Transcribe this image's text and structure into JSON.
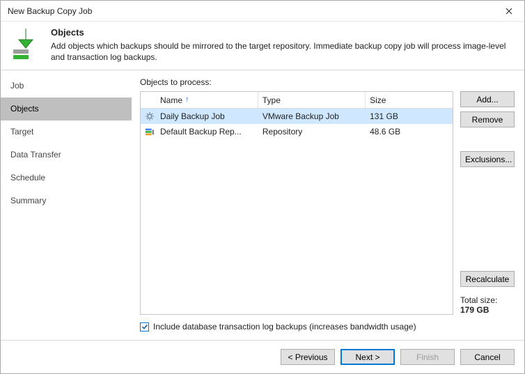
{
  "window": {
    "title": "New Backup Copy Job"
  },
  "header": {
    "title": "Objects",
    "description": "Add objects which backups should be mirrored to the target repository. Immediate backup copy job will process image-level and transaction log backups."
  },
  "nav": {
    "items": [
      {
        "label": "Job"
      },
      {
        "label": "Objects"
      },
      {
        "label": "Target"
      },
      {
        "label": "Data Transfer"
      },
      {
        "label": "Schedule"
      },
      {
        "label": "Summary"
      }
    ],
    "active_index": 1
  },
  "objects": {
    "label": "Objects to process:",
    "columns": {
      "name": "Name",
      "type": "Type",
      "size": "Size"
    },
    "rows": [
      {
        "name": "Daily Backup Job",
        "type": "VMware Backup Job",
        "size": "131 GB",
        "icon": "gear",
        "selected": true
      },
      {
        "name": "Default Backup Rep...",
        "type": "Repository",
        "size": "48.6 GB",
        "icon": "repository",
        "selected": false
      }
    ],
    "include_tlog_label": "Include database transaction log backups (increases bandwidth usage)",
    "include_tlog_checked": true
  },
  "buttons": {
    "add": "Add...",
    "remove": "Remove",
    "exclusions": "Exclusions...",
    "recalculate": "Recalculate",
    "previous": "< Previous",
    "next": "Next >",
    "finish": "Finish",
    "cancel": "Cancel"
  },
  "total": {
    "label": "Total size:",
    "value": "179 GB"
  }
}
